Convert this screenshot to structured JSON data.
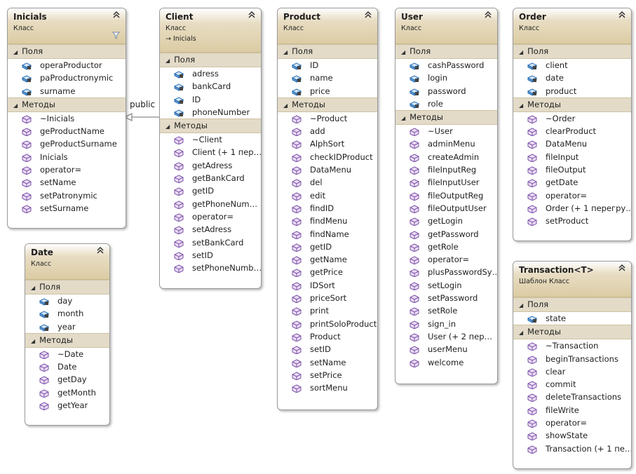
{
  "labels": {
    "fields": "Поля",
    "methods": "Методы",
    "class_kind": "Класс"
  },
  "connector": {
    "label": "public"
  },
  "classes": [
    {
      "name": "Inicials",
      "kind": "Класс",
      "inherits": "",
      "fields": [
        "operaProductor",
        "paProductronymic",
        "surname"
      ],
      "methods": [
        "~Inicials",
        "geProductName",
        "geProductSurname",
        "Inicials",
        "operator=",
        "setName",
        "setPatronymic",
        "setSurname"
      ]
    },
    {
      "name": "Client",
      "kind": "Класс",
      "inherits": "Inicials",
      "fields": [
        "adress",
        "bankCard",
        "ID",
        "phoneNumber"
      ],
      "methods": [
        "~Client",
        "Client (+ 1 пер…",
        "getAdress",
        "getBankCard",
        "getID",
        "getPhoneNum…",
        "operator=",
        "setAdress",
        "setBankCard",
        "setID",
        "setPhoneNumb…"
      ]
    },
    {
      "name": "Product",
      "kind": "Класс",
      "inherits": "",
      "fields": [
        "ID",
        "name",
        "price"
      ],
      "methods": [
        "~Product",
        "add",
        "AlphSort",
        "checkIDProduct",
        "DataMenu",
        "del",
        "edit",
        "findID",
        "findMenu",
        "findName",
        "getID",
        "getName",
        "getPrice",
        "IDSort",
        "priceSort",
        "print",
        "printSoloProduct",
        "Product",
        "setID",
        "setName",
        "setPrice",
        "sortMenu"
      ]
    },
    {
      "name": "User",
      "kind": "Класс",
      "inherits": "",
      "fields": [
        "cashPassword",
        "login",
        "password",
        "role"
      ],
      "methods": [
        "~User",
        "adminMenu",
        "createAdmin",
        "fileInputReg",
        "fileInputUser",
        "fileOutputReg",
        "fileOutputUser",
        "getLogin",
        "getPassword",
        "getRole",
        "operator=",
        "plusPasswordSy…",
        "setLogin",
        "setPassword",
        "setRole",
        "sign_in",
        "User (+ 2 пер…",
        "userMenu",
        "welcome"
      ]
    },
    {
      "name": "Order",
      "kind": "Класс",
      "inherits": "",
      "fields": [
        "client",
        "date",
        "product"
      ],
      "methods": [
        "~Order",
        "clearProduct",
        "DataMenu",
        "fileInput",
        "fileOutput",
        "getDate",
        "operator=",
        "Order (+ 1 перегру…",
        "setProduct"
      ]
    },
    {
      "name": "Date",
      "kind": "Класс",
      "inherits": "",
      "fields": [
        "day",
        "month",
        "year"
      ],
      "methods": [
        "~Date",
        "Date",
        "getDay",
        "getMonth",
        "getYear"
      ]
    },
    {
      "name": "Transaction<T>",
      "kind": "Шаблон Класс",
      "inherits": "",
      "fields": [
        "state"
      ],
      "methods": [
        "~Transaction",
        "beginTransactions",
        "clear",
        "commit",
        "deleteTransactions",
        "fileWrite",
        "operator=",
        "showState",
        "Transaction (+ 1 пе…"
      ]
    }
  ]
}
